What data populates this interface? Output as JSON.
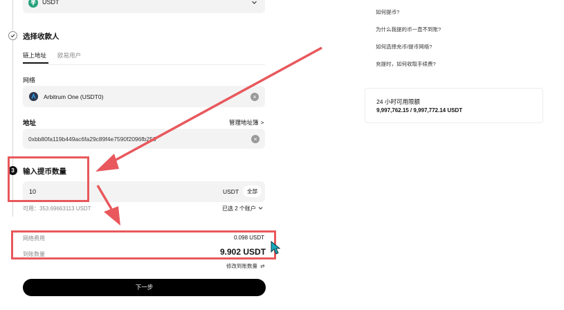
{
  "coin": {
    "value": "USDT"
  },
  "recipient": {
    "title": "选择收款人",
    "tabs": [
      {
        "label": "链上地址"
      },
      {
        "label": "欧易用户"
      }
    ]
  },
  "network": {
    "label": "网络",
    "value": "Arbitrum One (USDT0)"
  },
  "address": {
    "label": "地址",
    "manage_label": "管理地址簿",
    "value": "0xbb80fa119b449ac6fa29c89f4e7590f2096fb256"
  },
  "amount": {
    "step_number": "3",
    "title": "输入提币数量",
    "value": "10",
    "currency": "USDT",
    "all_label": "全部",
    "available": "可用：353.69663113 USDT",
    "selected_accounts": "已选 2 个账户"
  },
  "fees": {
    "network_fee_label": "网络费用",
    "network_fee_value": "0.098 USDT",
    "received_label": "到账数量",
    "received_value": "9.902 USDT",
    "modify_label": "修改到账数量"
  },
  "next_button": "下一步",
  "faq": {
    "items": [
      "如何提币?",
      "为什么我提的币一直不到账?",
      "如何选择充币/提币网络?",
      "充提时，如何收取手续费?"
    ]
  },
  "limit": {
    "title": "24 小时可用限额",
    "value": "9,997,762.15 / 9,997,772.14 USDT"
  },
  "colors": {
    "annotation_red": "#e8585c",
    "usdt_green": "#26a17b",
    "button_black": "#000000"
  }
}
